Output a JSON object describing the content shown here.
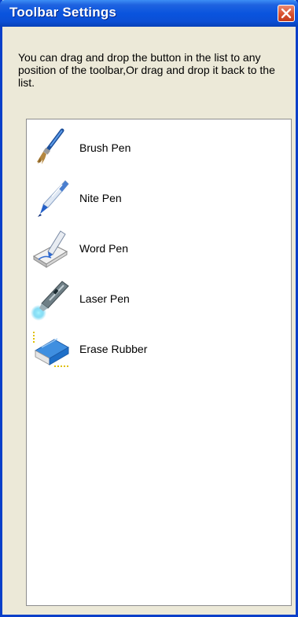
{
  "window": {
    "title": "Toolbar Settings",
    "close_icon": "close-icon",
    "description": "You can drag and drop the button in the list to any position of the toolbar,Or drag and drop it back to the list."
  },
  "list": {
    "items": [
      {
        "label": "Brush Pen",
        "icon": "brush-pen-icon"
      },
      {
        "label": "Nite Pen",
        "icon": "nite-pen-icon"
      },
      {
        "label": "Word Pen",
        "icon": "word-pen-icon"
      },
      {
        "label": "Laser Pen",
        "icon": "laser-pen-icon"
      },
      {
        "label": "Erase Rubber",
        "icon": "erase-rubber-icon"
      }
    ]
  },
  "colors": {
    "titlebar": "#0a54de",
    "window_bg": "#ece9d8",
    "close_button": "#d9512f",
    "list_bg": "#ffffff"
  }
}
